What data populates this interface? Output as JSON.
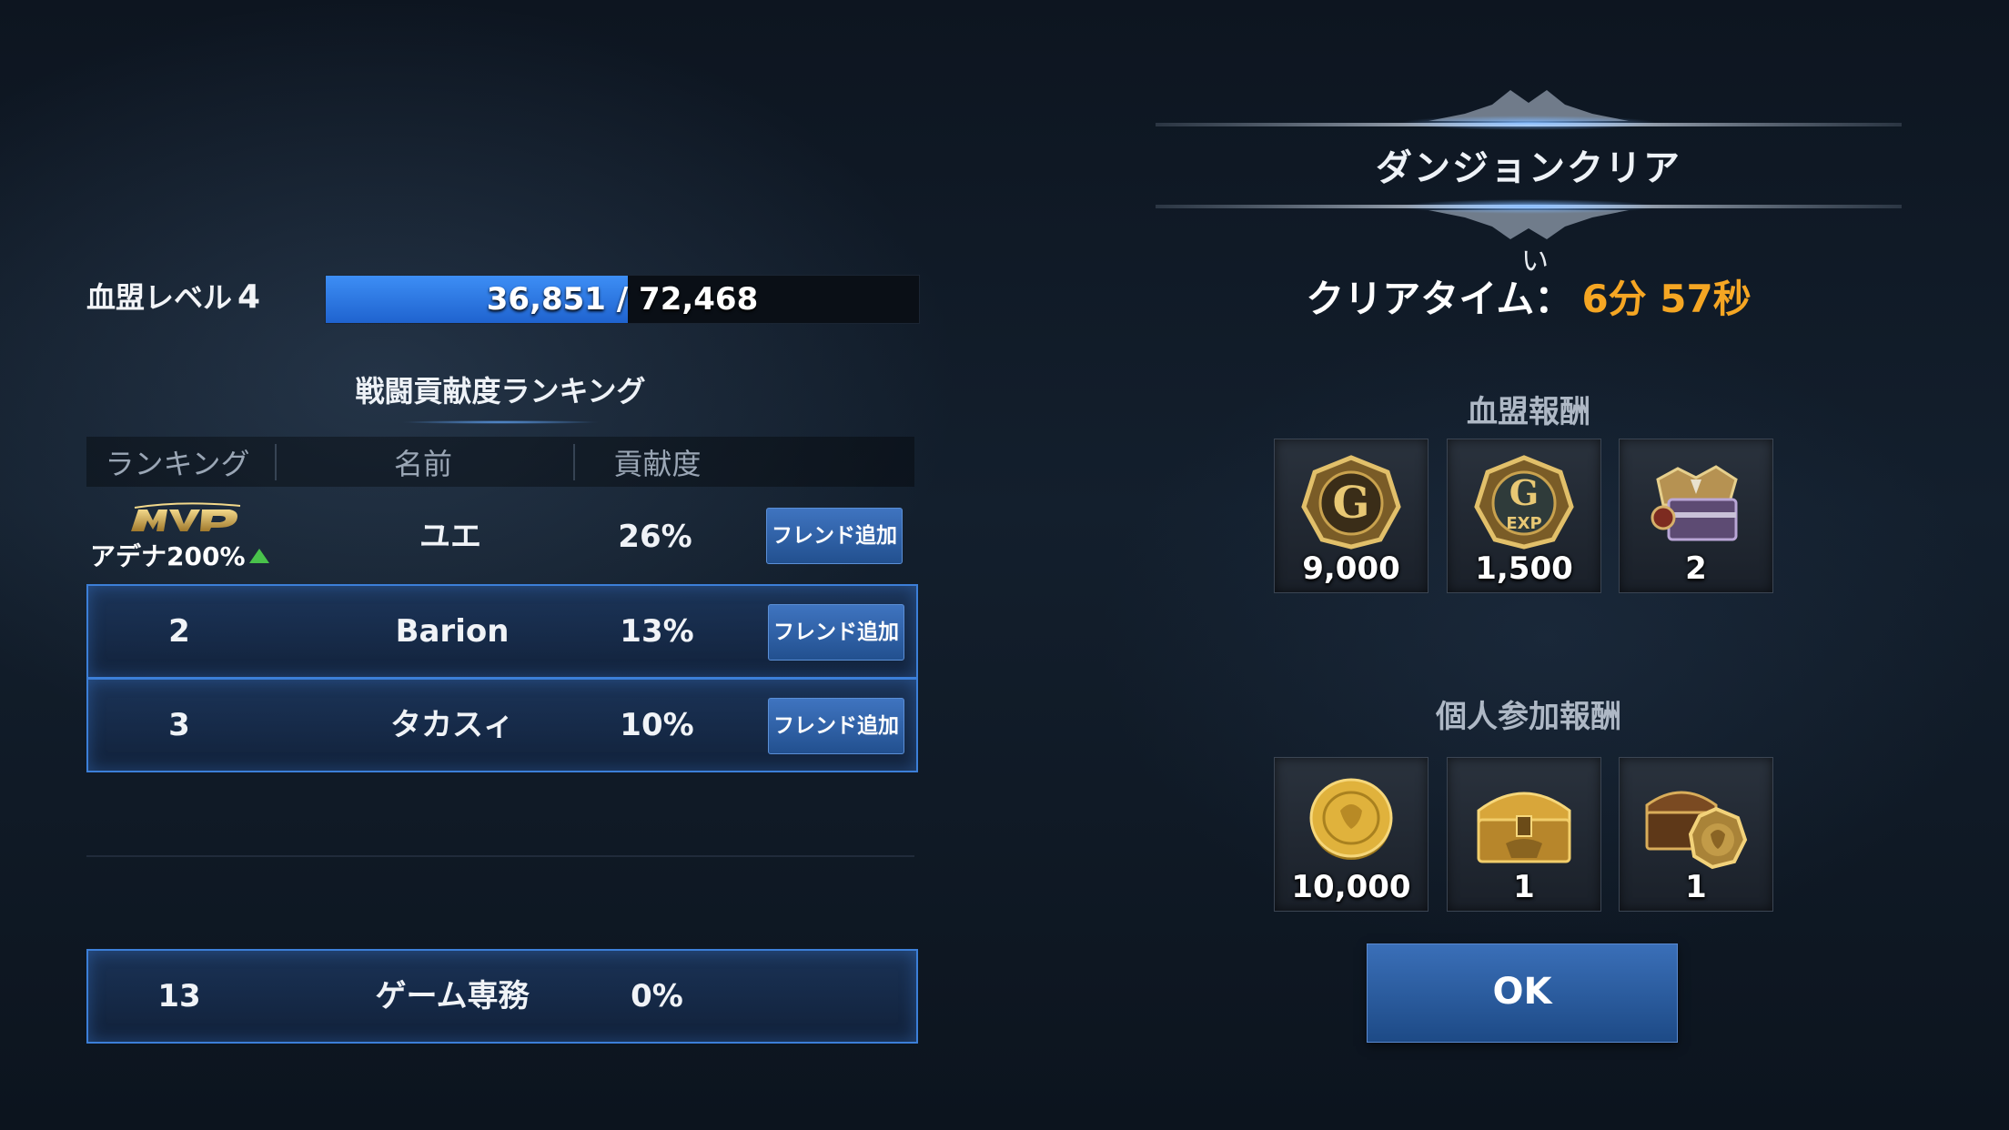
{
  "guild": {
    "label": "血盟レベル",
    "level": "4",
    "xp_text": "36,851 / 72,468",
    "xp_current": 36851,
    "xp_max": 72468
  },
  "ranking": {
    "title": "戦闘貢献度ランキング",
    "headers": {
      "rank": "ランキング",
      "name": "名前",
      "contribution": "貢献度"
    },
    "mvp": {
      "logo": "MVP",
      "bonus": "アデナ200%",
      "name": "ユエ",
      "pct": "26%",
      "button": "フレンド追加"
    },
    "rows": [
      {
        "rank": "2",
        "name": "Barion",
        "pct": "13%",
        "button": "フレンド追加"
      },
      {
        "rank": "3",
        "name": "タカスィ",
        "pct": "10%",
        "button": "フレンド追加"
      }
    ],
    "self": {
      "rank": "13",
      "name": "ゲーム専務",
      "pct": "0%"
    }
  },
  "result": {
    "title": "ダンジョンクリア",
    "mark": "い",
    "time_label": "クリアタイム：",
    "time_value": "6分 57秒"
  },
  "guild_rewards": {
    "title": "血盟報酬",
    "items": [
      {
        "icon": "guild-gold-coin-icon",
        "qty": "9,000"
      },
      {
        "icon": "guild-exp-coin-icon",
        "qty": "1,500"
      },
      {
        "icon": "armor-chest-icon",
        "qty": "2"
      }
    ]
  },
  "personal_rewards": {
    "title": "個人参加報酬",
    "items": [
      {
        "icon": "adena-coin-icon",
        "qty": "10,000"
      },
      {
        "icon": "gold-chest-icon",
        "qty": "1"
      },
      {
        "icon": "lion-chest-icon",
        "qty": "1"
      }
    ]
  },
  "ok_button": "OK",
  "colors": {
    "accent_blue": "#3d8ef5",
    "time_orange": "#f5a623",
    "up_green": "#49c24b"
  }
}
